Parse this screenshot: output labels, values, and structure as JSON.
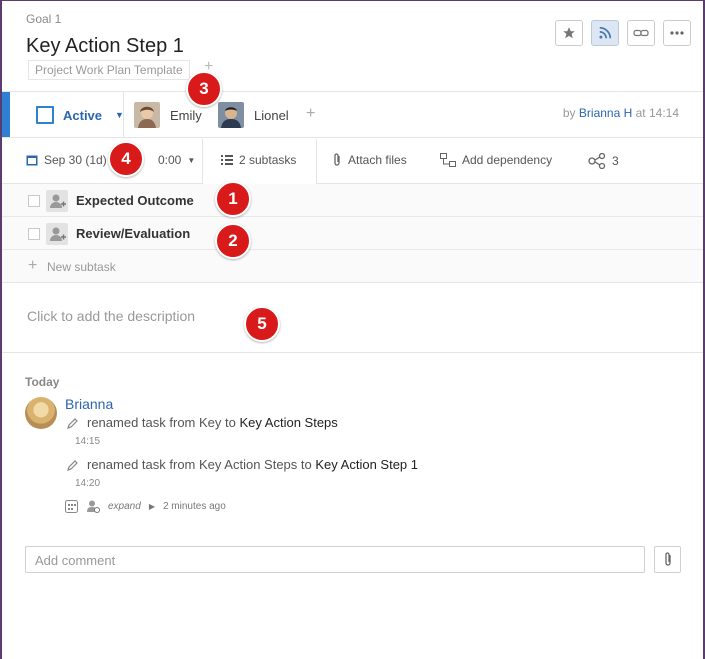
{
  "header": {
    "breadcrumb": "Goal 1",
    "title": "Key Action Step 1",
    "folder_tag": "Project Work Plan Template",
    "folder_add": "+"
  },
  "header_buttons": [
    "star-icon",
    "rss-icon",
    "link-icon",
    "more-icon"
  ],
  "status": {
    "label": "Active",
    "color": "#2f7fd2"
  },
  "assignees": [
    {
      "name": "Emily"
    },
    {
      "name": "Lionel"
    }
  ],
  "add_assignee": "+",
  "byline": {
    "prefix": "by",
    "author": "Brianna H",
    "suffix": "at 14:14"
  },
  "toolbar": {
    "date": "Sep 30 (1d)",
    "time": "0:00",
    "subtasks": "2 subtasks",
    "attach": "Attach files",
    "dependency": "Add dependency",
    "share_count": "3"
  },
  "subtasks": [
    {
      "title": "Expected Outcome"
    },
    {
      "title": "Review/Evaluation"
    }
  ],
  "new_subtask": "New subtask",
  "description_placeholder": "Click to add the description",
  "stream": {
    "day": "Today",
    "user": "Brianna",
    "activities": [
      {
        "prefix": "renamed task from",
        "from": "Key",
        "mid": "to",
        "to": "Key Action Steps",
        "time": "14:15"
      },
      {
        "prefix": "renamed task from",
        "from": "Key Action Steps",
        "mid": "to",
        "to": "Key Action Step 1",
        "time": "14:20"
      }
    ],
    "expand": "expand",
    "ago": "2 minutes ago"
  },
  "comment_placeholder": "Add comment",
  "markers": [
    "1",
    "2",
    "3",
    "4",
    "5"
  ],
  "colors": {
    "accent": "#2f7fd2",
    "link": "#2b66b0",
    "marker": "#d91a1a"
  }
}
